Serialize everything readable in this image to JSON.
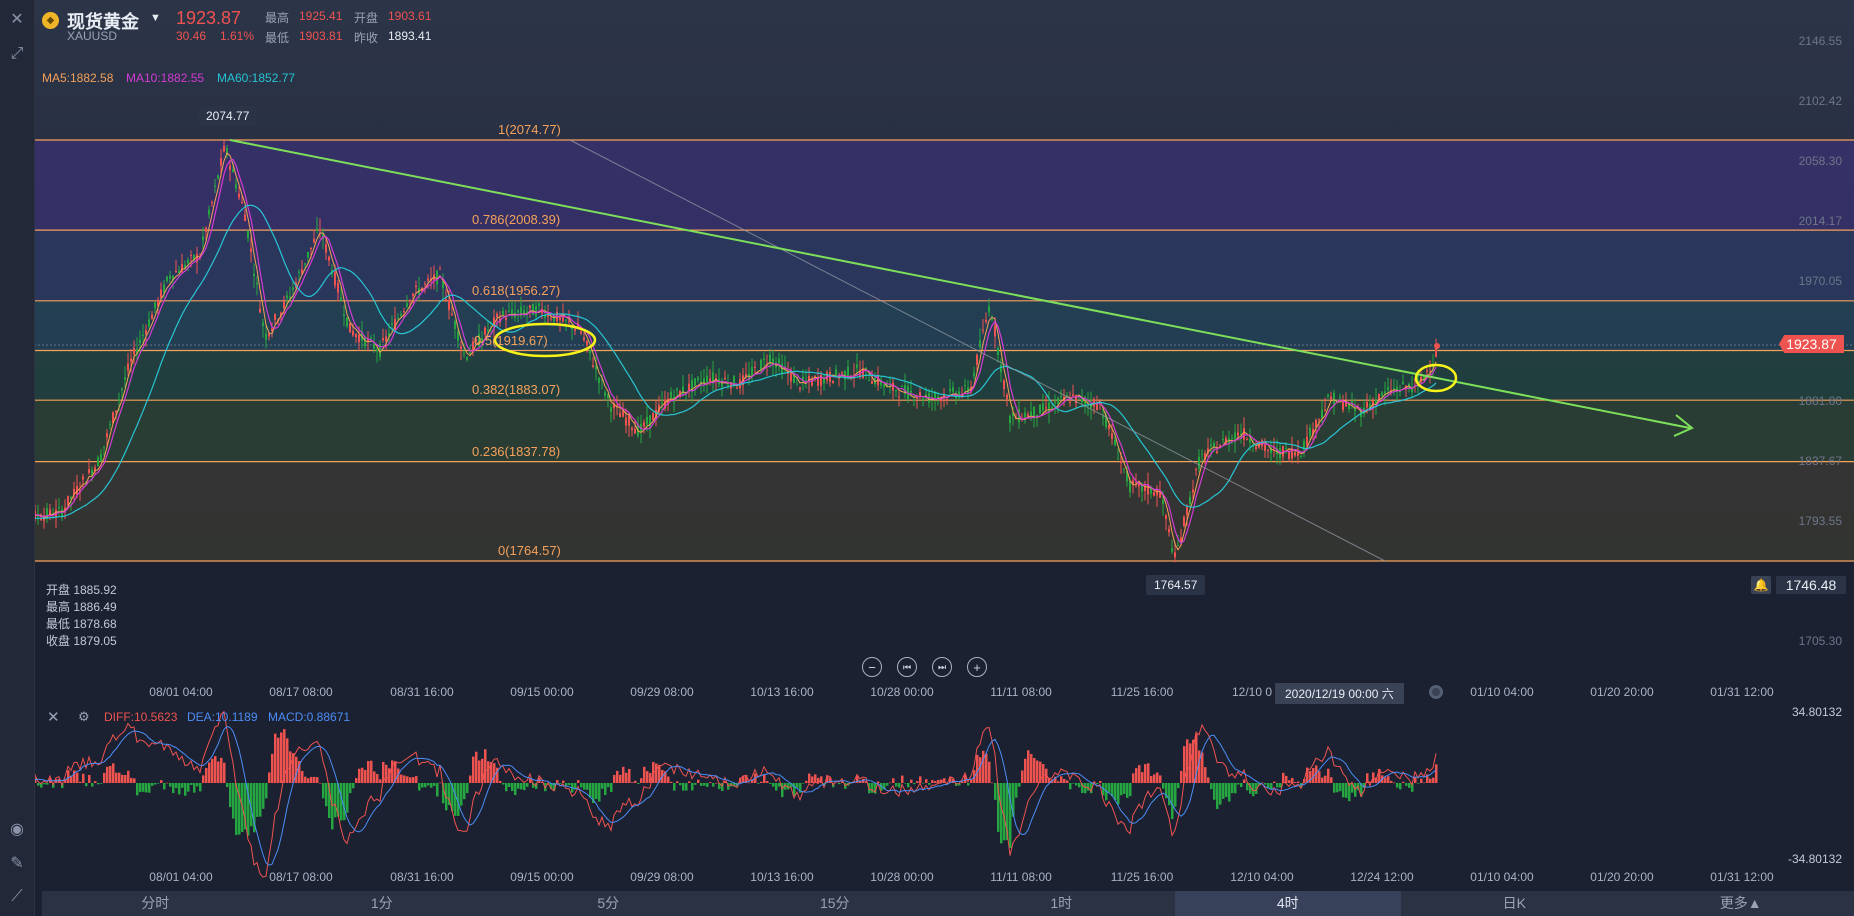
{
  "header": {
    "symbol_name": "现货黄金",
    "symbol_code": "XAUUSD",
    "price": "1923.87",
    "change": "30.46",
    "change_pct": "1.61%",
    "high_label": "最高",
    "high_value": "1925.41",
    "open_label": "开盘",
    "open_value": "1903.61",
    "low_label": "最低",
    "low_value": "1903.81",
    "prev_close_label": "昨收",
    "prev_close_value": "1893.41"
  },
  "ma": {
    "ma5": "MA5:1882.58",
    "ma10": "MA10:1882.55",
    "ma60": "MA60:1852.77"
  },
  "fib_levels": [
    {
      "label": "1(2074.77)",
      "value": 2074.77
    },
    {
      "label": "0.786(2008.39)",
      "value": 2008.39
    },
    {
      "label": "0.618(1956.27)",
      "value": 1956.27
    },
    {
      "label": "0.5(1919.67)",
      "value": 1919.67
    },
    {
      "label": "0.382(1883.07)",
      "value": 1883.07
    },
    {
      "label": "0.236(1837.78)",
      "value": 1837.78
    },
    {
      "label": "0(1764.57)",
      "value": 1764.57
    }
  ],
  "y_axis": [
    "2146.55",
    "2102.42",
    "2058.30",
    "2014.17",
    "1970.05",
    "1881.80",
    "1837.67",
    "1793.55",
    "1705.30"
  ],
  "price_tag": "1923.87",
  "alert_value": "1746.48",
  "high_marker": "2074.77",
  "low_marker": "1764.57",
  "ohlc_panel": {
    "open": "开盘 1885.92",
    "high": "最高 1886.49",
    "low": "最低 1878.68",
    "close": "收盘 1879.05"
  },
  "x_axis_top": [
    "08/01 04:00",
    "08/17 08:00",
    "08/31 16:00",
    "09/15 00:00",
    "09/29 08:00",
    "10/13 16:00",
    "10/28 00:00",
    "11/11 08:00",
    "11/25 16:00",
    "12/10 0",
    "01/10 04:00",
    "01/20 20:00",
    "01/31 12:00"
  ],
  "x_axis_bottom": [
    "08/01 04:00",
    "08/17 08:00",
    "08/31 16:00",
    "09/15 00:00",
    "09/29 08:00",
    "10/13 16:00",
    "10/28 00:00",
    "11/11 08:00",
    "11/25 16:00",
    "12/10 04:00",
    "12/24 12:00",
    "01/10 04:00",
    "01/20 20:00",
    "01/31 12:00"
  ],
  "crosshair_time": "2020/12/19 00:00 六",
  "macd": {
    "diff": "DIFF:10.5623",
    "dea": "DEA:10.1189",
    "macd": "MACD:0.88671",
    "top": "34.80132",
    "bottom": "-34.80132"
  },
  "tabs": [
    "分时",
    "1分",
    "5分",
    "15分",
    "1时",
    "4时",
    "日K",
    "更多▲"
  ],
  "active_tab": 5,
  "colors": {
    "up": "#ef5350",
    "down": "#26a641",
    "fib": "#f5a15a",
    "trend": "#7ee05a",
    "ma5": "#f5a15a",
    "ma10": "#d43bd4",
    "ma60": "#27c5d4",
    "highlight": "#f7f21a"
  }
}
